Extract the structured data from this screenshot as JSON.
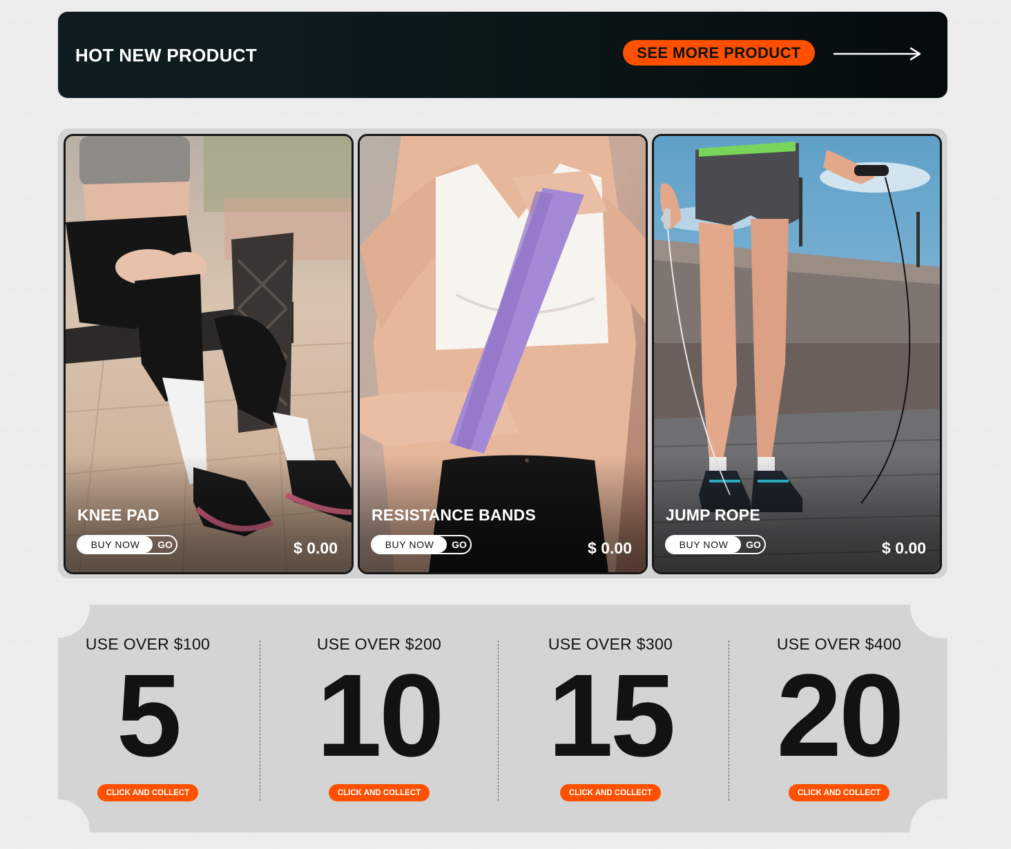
{
  "banner": {
    "title": "HOT NEW PRODUCT",
    "see_more_label": "SEE MORE PRODUCT",
    "arrow_icon": "arrow-right-icon"
  },
  "products": [
    {
      "name": "KNEE PAD",
      "buy_label": "BUY NOW",
      "go_label": "GO",
      "price": "$ 0.00"
    },
    {
      "name": "RESISTANCE BANDS",
      "buy_label": "BUY NOW",
      "go_label": "GO",
      "price": "$ 0.00"
    },
    {
      "name": "JUMP ROPE",
      "buy_label": "BUY NOW",
      "go_label": "GO",
      "price": "$ 0.00"
    }
  ],
  "coupons": [
    {
      "condition": "USE OVER $100",
      "amount": "5",
      "button": "CLICK AND COLLECT"
    },
    {
      "condition": "USE OVER $200",
      "amount": "10",
      "button": "CLICK AND COLLECT"
    },
    {
      "condition": "USE OVER $300",
      "amount": "15",
      "button": "CLICK AND COLLECT"
    },
    {
      "condition": "USE OVER $400",
      "amount": "20",
      "button": "CLICK AND COLLECT"
    }
  ],
  "colors": {
    "accent": "#fe5000",
    "banner_bg": "#0b1619",
    "coupon_bg": "#d4d4d4",
    "page_bg": "#ececec"
  }
}
